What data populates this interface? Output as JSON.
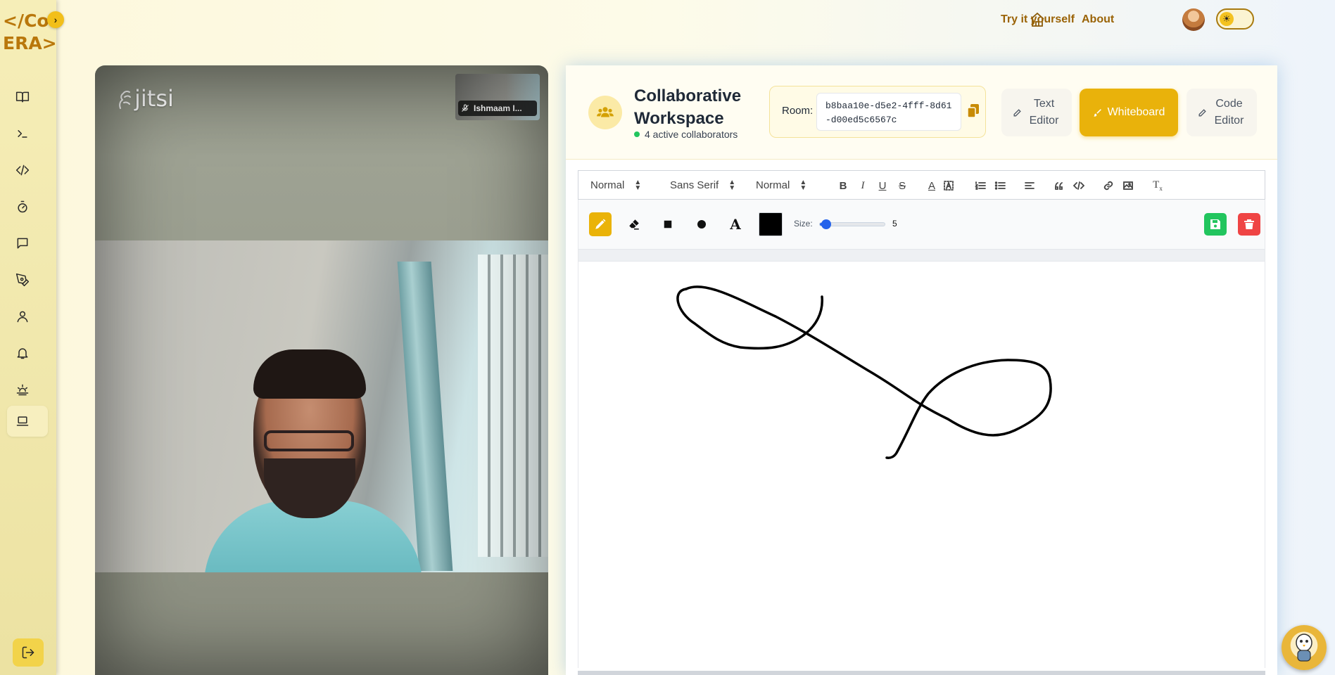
{
  "sidebar": {
    "logo_lines": [
      "</Cod",
      "ERA>"
    ],
    "collapse_icon": "chevron-right-icon",
    "items": [
      {
        "icon": "book-icon"
      },
      {
        "icon": "terminal-icon"
      },
      {
        "icon": "code-icon"
      },
      {
        "icon": "timer-icon"
      },
      {
        "icon": "chat-icon"
      },
      {
        "icon": "pen-tool-icon"
      },
      {
        "icon": "user-icon"
      },
      {
        "icon": "bell-icon"
      },
      {
        "icon": "sunrise-icon"
      },
      {
        "icon": "laptop-icon",
        "active": true
      }
    ],
    "logout_icon": "logout-icon"
  },
  "topnav": {
    "home_icon": "home-icon",
    "links": [
      "Try it yourself",
      "About"
    ],
    "avatar": "user-avatar",
    "theme_icon": "sun-icon"
  },
  "video": {
    "logo_text": "jitsi",
    "participant_name": "Ishmaam I..."
  },
  "workspace": {
    "title": "Collaborative Workspace",
    "collaborators": "4 active collaborators",
    "room_label": "Room:",
    "room_id": "b8baa10e-d5e2-4fff-8d61-d00ed5c6567c",
    "modes": [
      {
        "label": "Text Editor",
        "active": false
      },
      {
        "label": "Whiteboard",
        "active": true
      },
      {
        "label": "Code Editor",
        "active": false
      }
    ],
    "accent": "#e9b20b"
  },
  "editor_toolbar": {
    "header_select": "Normal",
    "font_select": "Sans Serif",
    "size_select": "Normal"
  },
  "whiteboard": {
    "tools": [
      "pencil-icon",
      "eraser-icon",
      "square-icon",
      "circle-icon",
      "text-icon"
    ],
    "active_tool": "pencil",
    "color": "#000000",
    "size_label": "Size:",
    "size_value": "5",
    "size_fraction": 0.1
  }
}
